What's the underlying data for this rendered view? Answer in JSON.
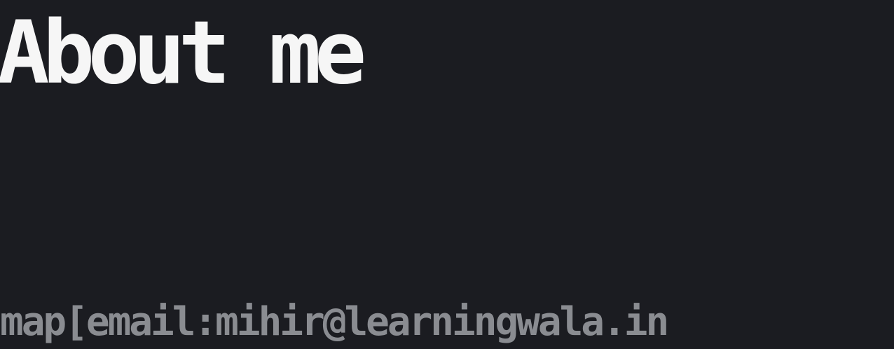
{
  "page": {
    "title": "About me",
    "meta_text": "map[email:mihir@learningwala.in"
  },
  "colors": {
    "background": "#1b1c21",
    "title": "#f6f6f6",
    "meta_text": "#8a8c91"
  }
}
